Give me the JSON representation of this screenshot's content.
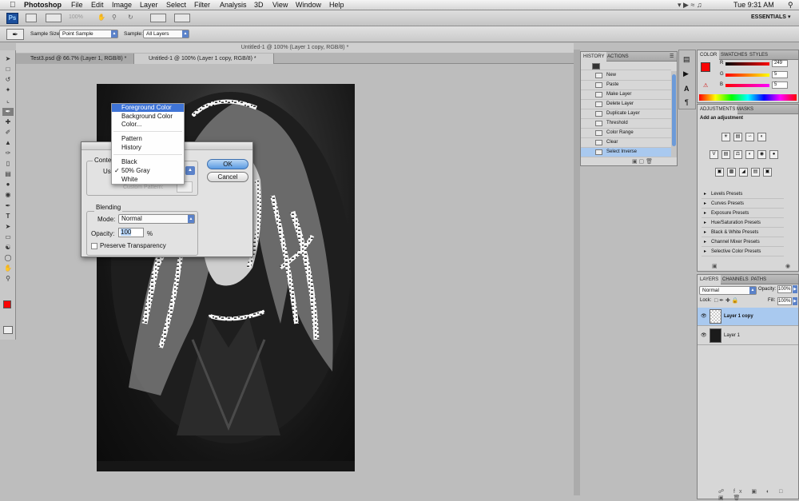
{
  "menubar": {
    "app": "Photoshop",
    "items": [
      "File",
      "Edit",
      "Image",
      "Layer",
      "Select",
      "Filter",
      "Analysis",
      "3D",
      "View",
      "Window",
      "Help"
    ],
    "clock": "Tue 9:31 AM"
  },
  "appbar": {
    "zoom": "100%",
    "workspace": "ESSENTIALS"
  },
  "options": {
    "sample_size_label": "Sample Size:",
    "sample_size": "Point Sample",
    "sample_label": "Sample:",
    "sample": "All Layers"
  },
  "document": {
    "title": "Untitled-1 @ 100% (Layer 1 copy, RGB/8) *",
    "tabs": [
      "Test3.psd @ 66.7% (Layer 1, RGB/8) *",
      "Untitled-1 @ 100% (Layer 1 copy, RGB/8) *"
    ]
  },
  "history": {
    "tabs": [
      "HISTORY",
      "ACTIONS"
    ],
    "items": [
      "New",
      "Paste",
      "Make Layer",
      "Delete Layer",
      "Duplicate Layer",
      "Threshold",
      "Color Range",
      "Clear",
      "Select Inverse"
    ]
  },
  "color_panel": {
    "tabs": [
      "COLOR",
      "SWATCHES",
      "STYLES"
    ],
    "channels": [
      {
        "name": "R",
        "value": "249"
      },
      {
        "name": "G",
        "value": "5"
      },
      {
        "name": "B",
        "value": "5"
      }
    ],
    "foreground": "#f90505"
  },
  "adjustments": {
    "tabs": [
      "ADJUSTMENTS",
      "MASKS"
    ],
    "heading": "Add an adjustment",
    "presets": [
      "Levels Presets",
      "Curves Presets",
      "Exposure Presets",
      "Hue/Saturation Presets",
      "Black & White Presets",
      "Channel Mixer Presets",
      "Selective Color Presets"
    ]
  },
  "layers": {
    "tabs": [
      "LAYERS",
      "CHANNELS",
      "PATHS"
    ],
    "blend_mode": "Normal",
    "opacity_label": "Opacity:",
    "opacity": "100%",
    "lock_label": "Lock:",
    "fill_label": "Fill:",
    "fill": "100%",
    "items": [
      "Layer 1 copy",
      "Layer 1"
    ]
  },
  "fill_dialog": {
    "contents_label": "Conte",
    "use_label": "Us",
    "custom_pattern_label": "Custom Pattern:",
    "blending_label": "Blending",
    "mode_label": "Mode:",
    "mode": "Normal",
    "opacity_label": "Opacity:",
    "opacity": "100",
    "percent": "%",
    "preserve_label": "Preserve Transparency",
    "ok": "OK",
    "cancel": "Cancel"
  },
  "dropdown": {
    "items": [
      "Foreground Color",
      "Background Color",
      "Color...",
      "Pattern",
      "History",
      "Black",
      "50% Gray",
      "White"
    ],
    "highlighted": "Foreground Color",
    "checked": "50% Gray"
  }
}
